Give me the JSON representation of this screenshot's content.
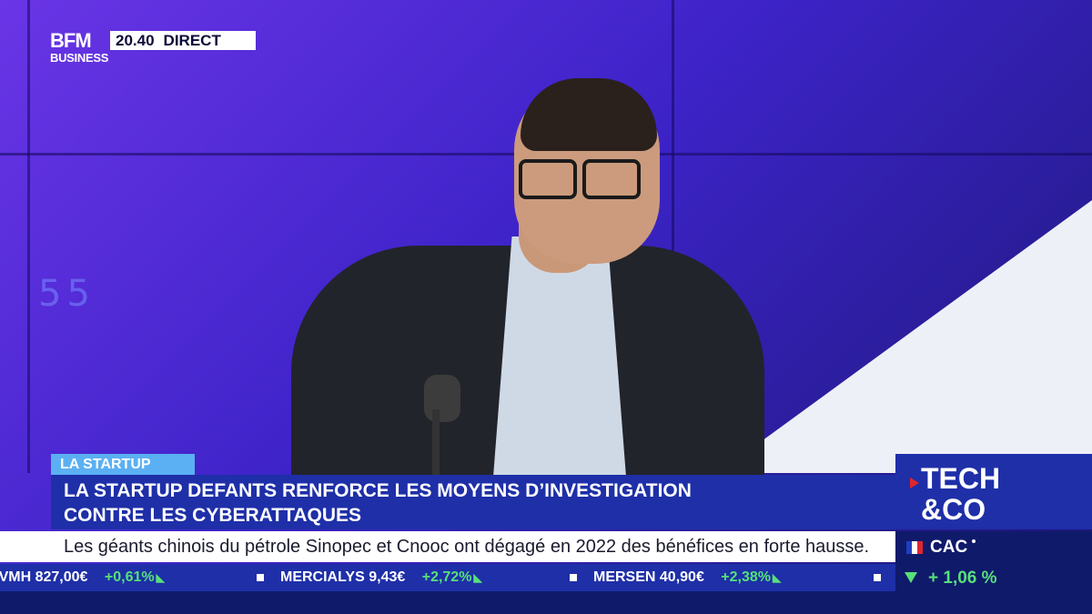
{
  "channel": {
    "logo_top": "BFM",
    "logo_bottom": "BUSINESS",
    "time": "20.40",
    "live_label": "DIRECT"
  },
  "lower_third": {
    "tag": "LA STARTUP",
    "headline_line1": "LA STARTUP DEFANTS RENFORCE LES MOYENS D’INVESTIGATION",
    "headline_line2": "CONTRE LES CYBERATTAQUES"
  },
  "news_ticker": "Les géants chinois du pétrole Sinopec et Cnooc ont dégagé en 2022 des bénéfices en forte hausse.",
  "stocks": [
    {
      "name": "LVMH",
      "price": "827,00€",
      "change": "+0,61%"
    },
    {
      "name": "MERCIALYS",
      "price": "9,43€",
      "change": "+2,72%"
    },
    {
      "name": "MERSEN",
      "price": "40,90€",
      "change": "+2,38%"
    }
  ],
  "show": {
    "line1": "TECH",
    "line2": "&CO"
  },
  "index": {
    "name": "CAC",
    "change": "+ 1,06 %"
  },
  "studio": {
    "background_digits": "55"
  },
  "colors": {
    "accent_blue": "#1e2fa8",
    "tag_blue": "#5bb0f3",
    "gain_green": "#57e07a",
    "show_red": "#e0262e"
  }
}
